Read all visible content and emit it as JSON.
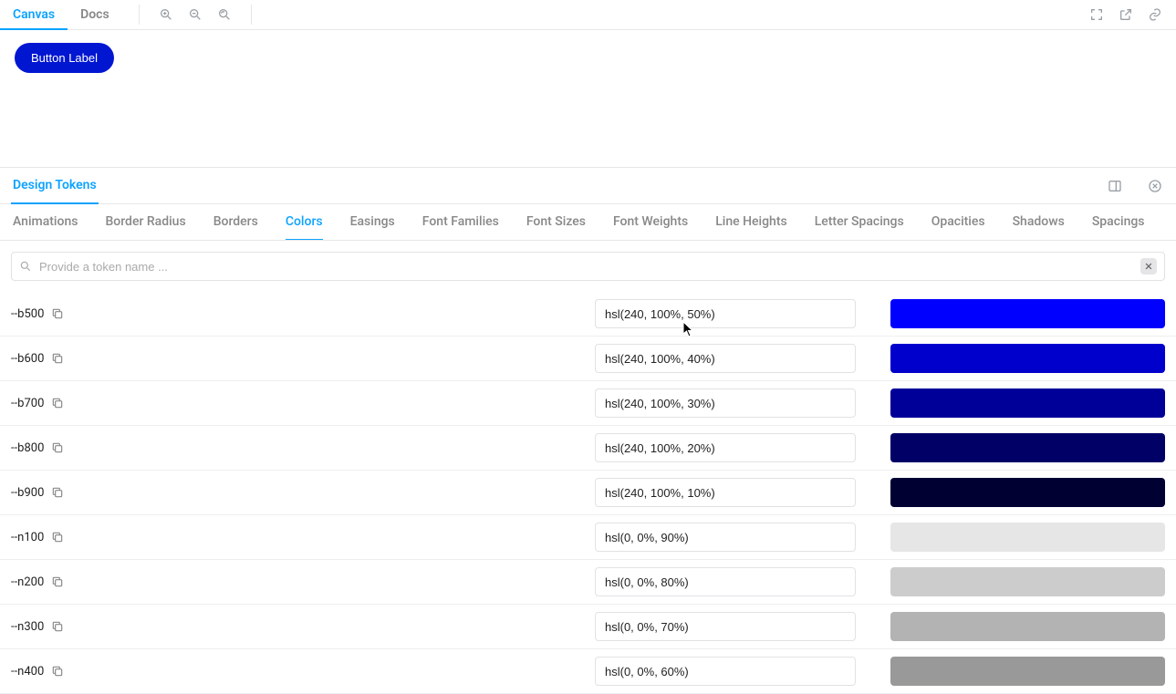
{
  "viewTabs": [
    {
      "label": "Canvas",
      "active": true
    },
    {
      "label": "Docs",
      "active": false
    }
  ],
  "sampleButton": {
    "label": "Button Label"
  },
  "panel": {
    "title": "Design Tokens"
  },
  "categories": [
    {
      "label": "Animations",
      "active": false
    },
    {
      "label": "Border Radius",
      "active": false
    },
    {
      "label": "Borders",
      "active": false
    },
    {
      "label": "Colors",
      "active": true
    },
    {
      "label": "Easings",
      "active": false
    },
    {
      "label": "Font Families",
      "active": false
    },
    {
      "label": "Font Sizes",
      "active": false
    },
    {
      "label": "Font Weights",
      "active": false
    },
    {
      "label": "Line Heights",
      "active": false
    },
    {
      "label": "Letter Spacings",
      "active": false
    },
    {
      "label": "Opacities",
      "active": false
    },
    {
      "label": "Shadows",
      "active": false
    },
    {
      "label": "Spacings",
      "active": false
    }
  ],
  "search": {
    "placeholder": "Provide a token name ...",
    "value": ""
  },
  "tokens": [
    {
      "name": "--b500",
      "value": "hsl(240, 100%, 50%)",
      "color": "hsl(240, 100%, 50%)"
    },
    {
      "name": "--b600",
      "value": "hsl(240, 100%, 40%)",
      "color": "hsl(240, 100%, 40%)"
    },
    {
      "name": "--b700",
      "value": "hsl(240, 100%, 30%)",
      "color": "hsl(240, 100%, 30%)"
    },
    {
      "name": "--b800",
      "value": "hsl(240, 100%, 20%)",
      "color": "hsl(240, 100%, 20%)"
    },
    {
      "name": "--b900",
      "value": "hsl(240, 100%, 10%)",
      "color": "hsl(240, 100%, 10%)"
    },
    {
      "name": "--n100",
      "value": "hsl(0, 0%, 90%)",
      "color": "hsl(0, 0%, 90%)"
    },
    {
      "name": "--n200",
      "value": "hsl(0, 0%, 80%)",
      "color": "hsl(0, 0%, 80%)"
    },
    {
      "name": "--n300",
      "value": "hsl(0, 0%, 70%)",
      "color": "hsl(0, 0%, 70%)"
    },
    {
      "name": "--n400",
      "value": "hsl(0, 0%, 60%)",
      "color": "hsl(0, 0%, 60%)"
    }
  ]
}
